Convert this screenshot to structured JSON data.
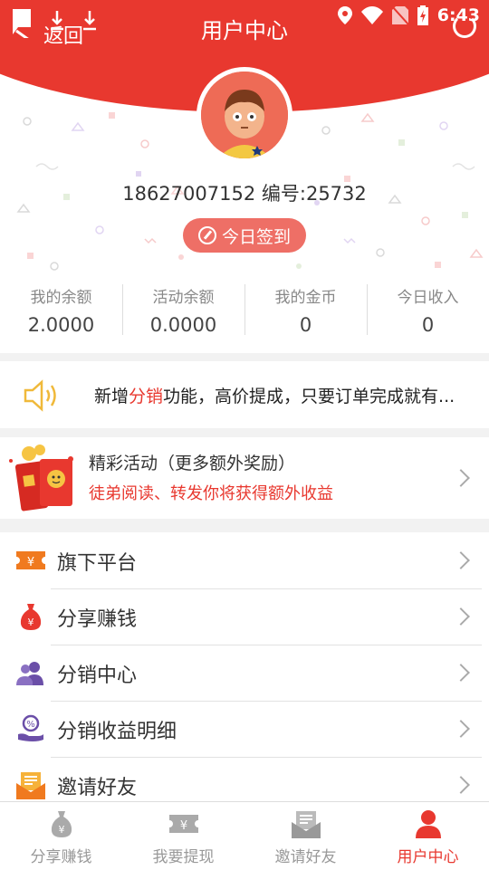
{
  "header": {
    "back_label": "返回",
    "title": "用户中心",
    "time": "6:43"
  },
  "profile": {
    "phone": "18627007152",
    "id_label": "编号:25732",
    "checkin_label": "今日签到"
  },
  "stats": [
    {
      "label": "我的余额",
      "value": "2.0000"
    },
    {
      "label": "活动余额",
      "value": "0.0000"
    },
    {
      "label": "我的金币",
      "value": "0"
    },
    {
      "label": "今日收入",
      "value": "0"
    }
  ],
  "notice": {
    "prefix": "新增",
    "highlight": "分销",
    "suffix": "功能，高价提成，只要订单完成就有..."
  },
  "activity": {
    "title": "精彩活动（更多额外奖励）",
    "subtitle": "徒弟阅读、转发你将获得额外收益"
  },
  "menu": [
    {
      "label": "旗下平台",
      "icon": "yen-ticket-icon"
    },
    {
      "label": "分享赚钱",
      "icon": "money-bag-icon"
    },
    {
      "label": "分销中心",
      "icon": "users-icon"
    },
    {
      "label": "分销收益明细",
      "icon": "percent-hand-icon"
    },
    {
      "label": "邀请好友",
      "icon": "envelope-icon"
    }
  ],
  "tabs": [
    {
      "label": "分享赚钱",
      "icon": "money-bag-icon",
      "active": false
    },
    {
      "label": "我要提现",
      "icon": "yen-ticket-icon",
      "active": false
    },
    {
      "label": "邀请好友",
      "icon": "envelope-icon",
      "active": false
    },
    {
      "label": "用户中心",
      "icon": "user-icon",
      "active": true
    }
  ],
  "colors": {
    "brand_red": "#e8382f",
    "checkin_bg": "#ee6f66",
    "icon_orange": "#f07a1f",
    "icon_purple": "#6b4fa8"
  }
}
